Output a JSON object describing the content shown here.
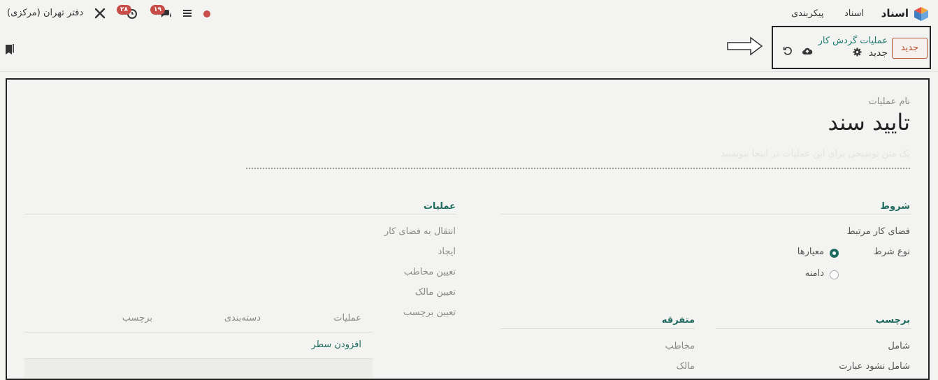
{
  "navbar": {
    "app_name": "اسناد",
    "menu": [
      "اسناد",
      "پیکربندی"
    ],
    "company": "دفتر تهران (مرکزی)",
    "badges": {
      "activity": "۲۸",
      "messages": "۱۹"
    },
    "colors": {
      "badge": "#c84c48",
      "status_dot": "#c84c48"
    }
  },
  "control_panel": {
    "new_button": "جدید",
    "breadcrumb_parent": "عملیات گردش کار",
    "breadcrumb_current": "جدید"
  },
  "form": {
    "name_label": "نام عملیات",
    "name_value": "تایید سند",
    "description_placeholder": "یک متن توضیحی برای این عملیات در اینجا بنویسید",
    "conditions": {
      "title": "شروط",
      "related_workspace": "فضای کار مرتبط",
      "condition_type_label": "نوع شرط",
      "options": [
        "معیارها",
        "دامنه"
      ],
      "selected": "معیارها"
    },
    "actions": {
      "title": "عملیات",
      "items": [
        "انتقال به فضای کار",
        "ایجاد",
        "تعیین مخاطب",
        "تعیین مالک",
        "تعیین برچسب"
      ]
    },
    "tags_table": {
      "columns": [
        "عملیات",
        "دسته‌بندی",
        "برچسب"
      ],
      "add_line": "افزودن سطر"
    },
    "tag_section": {
      "title": "برچسب",
      "fields": [
        "شامل",
        "شامل نشود عبارت"
      ]
    },
    "misc_section": {
      "title": "متفرقه",
      "fields": [
        "مخاطب",
        "مالک"
      ]
    }
  }
}
